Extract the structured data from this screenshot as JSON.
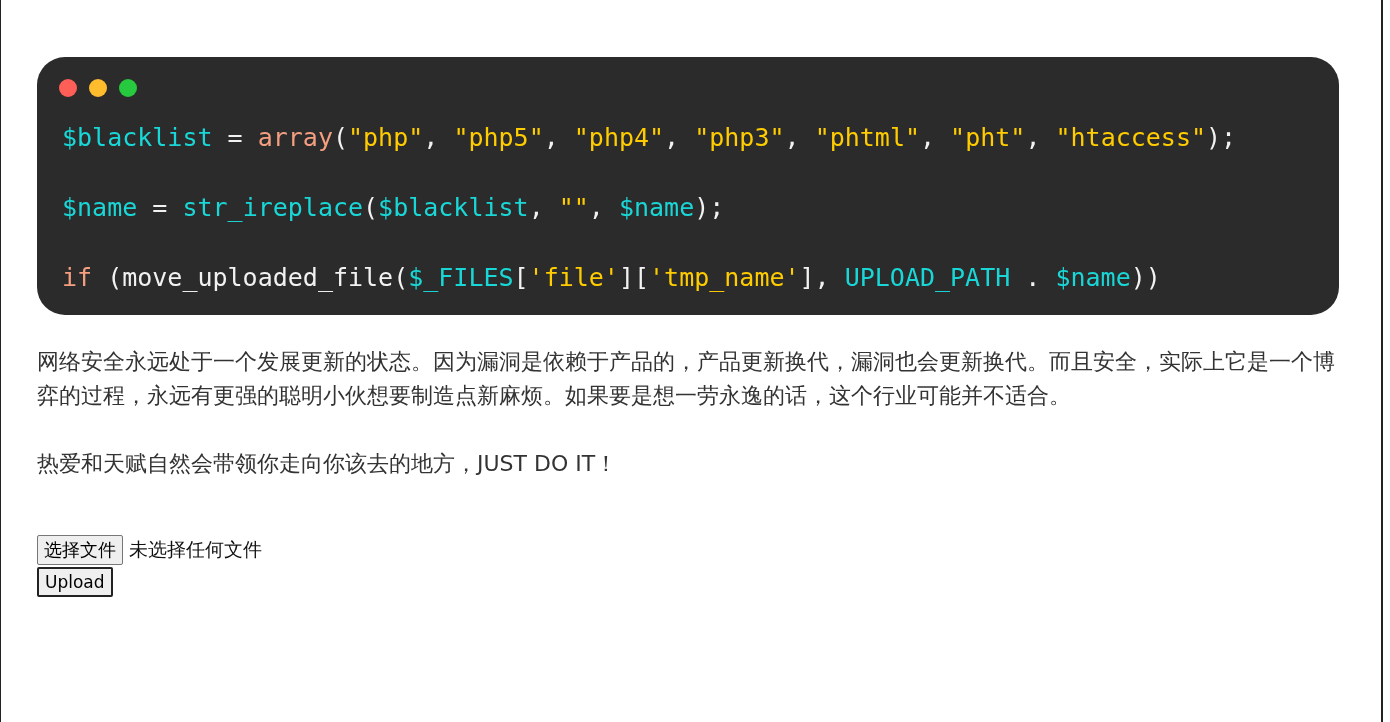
{
  "code_window": {
    "dots": [
      {
        "color": "#ff5f56"
      },
      {
        "color": "#ffbd2e"
      },
      {
        "color": "#27c93f"
      }
    ],
    "lines": [
      [
        {
          "kind": "var",
          "text": "$blacklist"
        },
        {
          "kind": "plain",
          "text": " = "
        },
        {
          "kind": "keyword",
          "text": "array"
        },
        {
          "kind": "plain",
          "text": "("
        },
        {
          "kind": "string",
          "text": "\"php\""
        },
        {
          "kind": "plain",
          "text": ", "
        },
        {
          "kind": "string",
          "text": "\"php5\""
        },
        {
          "kind": "plain",
          "text": ", "
        },
        {
          "kind": "string",
          "text": "\"php4\""
        },
        {
          "kind": "plain",
          "text": ", "
        },
        {
          "kind": "string",
          "text": "\"php3\""
        },
        {
          "kind": "plain",
          "text": ", "
        },
        {
          "kind": "string",
          "text": "\"phtml\""
        },
        {
          "kind": "plain",
          "text": ", "
        },
        {
          "kind": "string",
          "text": "\"pht\""
        },
        {
          "kind": "plain",
          "text": ", "
        },
        {
          "kind": "string",
          "text": "\"htaccess\""
        },
        {
          "kind": "plain",
          "text": ");"
        }
      ],
      [
        {
          "kind": "var",
          "text": "$name"
        },
        {
          "kind": "plain",
          "text": " = "
        },
        {
          "kind": "var",
          "text": "str_ireplace"
        },
        {
          "kind": "plain",
          "text": "("
        },
        {
          "kind": "var",
          "text": "$blacklist"
        },
        {
          "kind": "plain",
          "text": ", "
        },
        {
          "kind": "string",
          "text": "\"\""
        },
        {
          "kind": "plain",
          "text": ", "
        },
        {
          "kind": "var",
          "text": "$name"
        },
        {
          "kind": "plain",
          "text": ");"
        }
      ],
      [
        {
          "kind": "keyword",
          "text": "if"
        },
        {
          "kind": "plain",
          "text": " (move_uploaded_file("
        },
        {
          "kind": "var",
          "text": "$_FILES"
        },
        {
          "kind": "plain",
          "text": "["
        },
        {
          "kind": "string",
          "text": "'file'"
        },
        {
          "kind": "plain",
          "text": "]["
        },
        {
          "kind": "string",
          "text": "'tmp_name'"
        },
        {
          "kind": "plain",
          "text": "], "
        },
        {
          "kind": "var",
          "text": "UPLOAD_PATH"
        },
        {
          "kind": "plain",
          "text": " . "
        },
        {
          "kind": "var",
          "text": "$name"
        },
        {
          "kind": "plain",
          "text": "))"
        }
      ]
    ]
  },
  "paragraphs": [
    "网络安全永远处于一个发展更新的状态。因为漏洞是依赖于产品的，产品更新换代，漏洞也会更新换代。而且安全，实际上它是一个博弈的过程，永远有更强的聪明小伙想要制造点新麻烦。如果要是想一劳永逸的话，这个行业可能并不适合。",
    "热爱和天赋自然会带领你走向你该去的地方，JUST DO IT！"
  ],
  "file_input": {
    "button": "选择文件",
    "status": "未选择任何文件"
  },
  "upload_button": "Upload"
}
